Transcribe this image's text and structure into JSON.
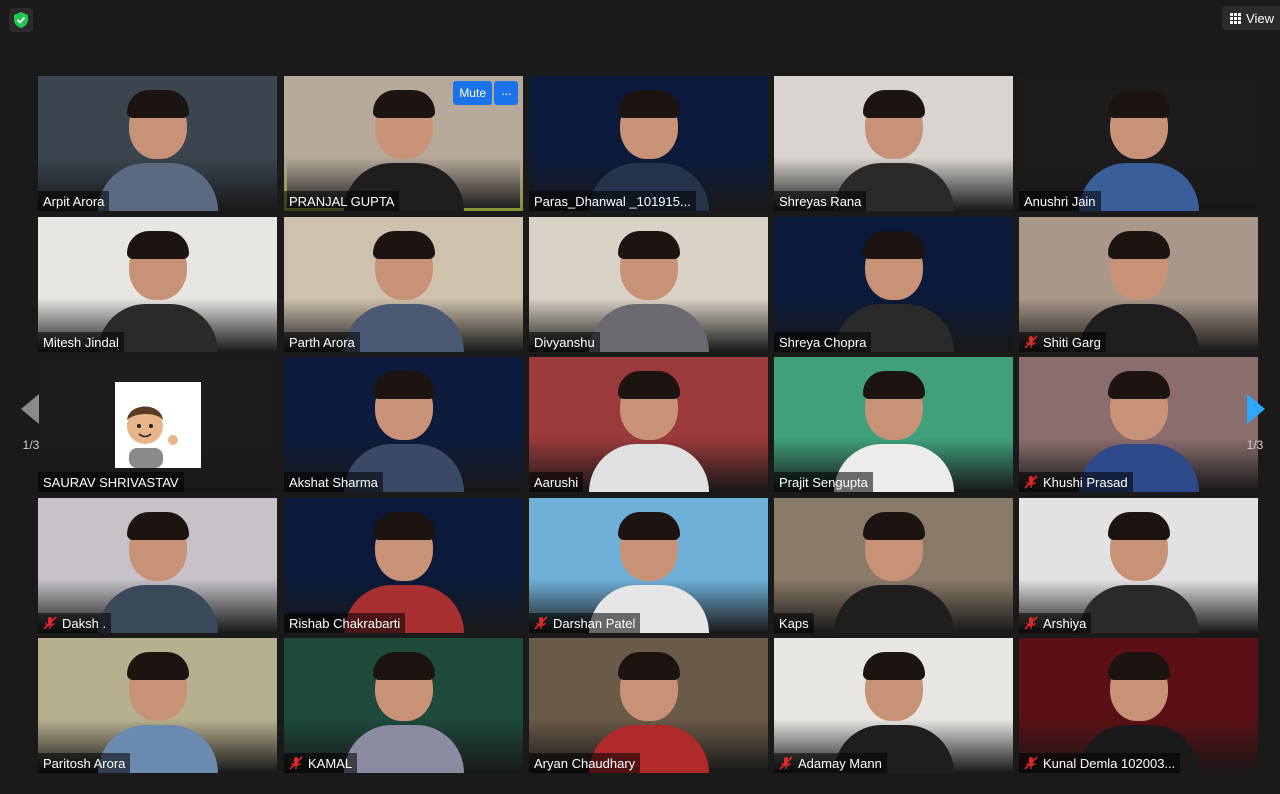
{
  "toolbar": {
    "view_label": "View"
  },
  "pagination": {
    "left": "1/3",
    "right": "1/3"
  },
  "active_controls": {
    "mute_label": "Mute",
    "more_label": "···"
  },
  "participants": [
    {
      "name": "Arpit Arora",
      "muted": false,
      "bg": "#3a4550",
      "shirt": "#5a6a80"
    },
    {
      "name": "PRANJAL GUPTA",
      "muted": false,
      "bg": "#b6a99a",
      "shirt": "#1e1e1e",
      "active": true
    },
    {
      "name": "Paras_Dhanwal _101915...",
      "muted": false,
      "bg": "#0b1a3a",
      "shirt": "#24324a"
    },
    {
      "name": "Shreyas Rana",
      "muted": false,
      "bg": "#d8d4cf",
      "shirt": "#2a2a2a"
    },
    {
      "name": "Anushri Jain",
      "muted": false,
      "bg": "#1c1c1c",
      "shirt": "#3a5e9a"
    },
    {
      "name": "Mitesh Jindal",
      "muted": false,
      "bg": "#e8e6e2",
      "shirt": "#2a2a2a"
    },
    {
      "name": "Parth Arora",
      "muted": false,
      "bg": "#cfc2ad",
      "shirt": "#4a5a74"
    },
    {
      "name": "Divyanshu",
      "muted": false,
      "bg": "#d9d2c6",
      "shirt": "#6a6a70"
    },
    {
      "name": "Shreya Chopra",
      "muted": false,
      "bg": "#0b1a3a",
      "shirt": "#2a2a2a"
    },
    {
      "name": "Shiti Garg",
      "muted": true,
      "bg": "#a9978a",
      "shirt": "#1e1e1e"
    },
    {
      "name": "SAURAV SHRIVASTAV",
      "muted": false,
      "bg": "#1c1c1c",
      "shirt": "#1c1c1c",
      "avatar": true
    },
    {
      "name": "Akshat Sharma",
      "muted": false,
      "bg": "#0d1c3d",
      "shirt": "#3a4a66"
    },
    {
      "name": "Aarushi",
      "muted": false,
      "bg": "#9a3a3a",
      "shirt": "#e0e0e0"
    },
    {
      "name": "Prajit Sengupta",
      "muted": false,
      "bg": "#3fa07a",
      "shirt": "#ececec"
    },
    {
      "name": "Khushi Prasad",
      "muted": true,
      "bg": "#8a6e6e",
      "shirt": "#2d4a8a"
    },
    {
      "name": "Daksh .",
      "muted": true,
      "bg": "#c6c2c8",
      "shirt": "#3a4a5a"
    },
    {
      "name": "Rishab Chakrabarti",
      "muted": false,
      "bg": "#0b1a3a",
      "shirt": "#a83030"
    },
    {
      "name": "Darshan Patel",
      "muted": true,
      "bg": "#6fb0d8",
      "shirt": "#e6e6e6"
    },
    {
      "name": "Kaps",
      "muted": false,
      "bg": "#8a7a68",
      "shirt": "#1e1e1e"
    },
    {
      "name": "Arshiya",
      "muted": true,
      "bg": "#e2e2e2",
      "shirt": "#2a2a2a"
    },
    {
      "name": "Paritosh Arora",
      "muted": false,
      "bg": "#b7b08f",
      "shirt": "#6a8ab0"
    },
    {
      "name": "KAMAL",
      "muted": true,
      "bg": "#1d4a3a",
      "shirt": "#8a8aa0"
    },
    {
      "name": "Aryan Chaudhary",
      "muted": false,
      "bg": "#6a5a48",
      "shirt": "#b02a2a"
    },
    {
      "name": "Adamay Mann",
      "muted": true,
      "bg": "#e8e6e2",
      "shirt": "#1e1e1e"
    },
    {
      "name": "Kunal Demla 102003...",
      "muted": true,
      "bg": "#5a1014",
      "shirt": "#1a1a1a"
    }
  ]
}
